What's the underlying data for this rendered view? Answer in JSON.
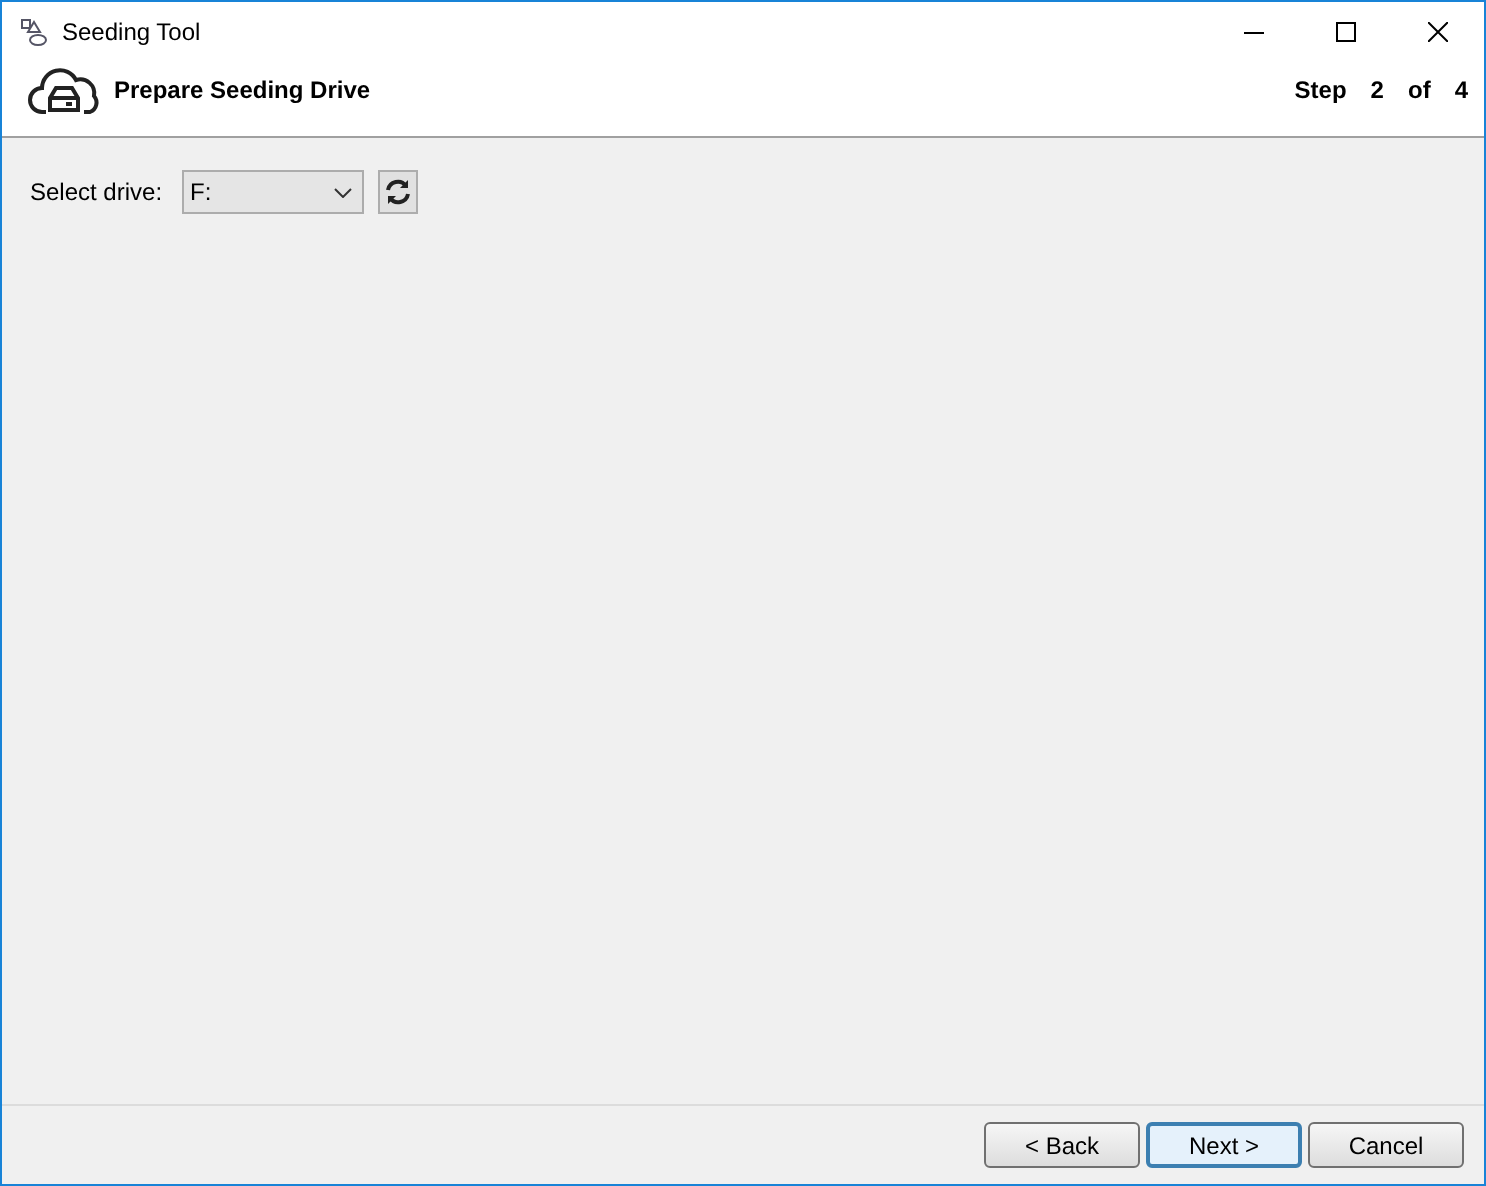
{
  "window": {
    "title": "Seeding Tool"
  },
  "header": {
    "title": "Prepare Seeding Drive",
    "step": [
      "Step",
      "2",
      "of",
      "4"
    ]
  },
  "drive": {
    "label": "Select drive:",
    "value": "F:"
  },
  "buttons": [
    {
      "label": "< Back",
      "default": false
    },
    {
      "label": "Next >",
      "default": true
    },
    {
      "label": "Cancel",
      "default": false
    }
  ]
}
